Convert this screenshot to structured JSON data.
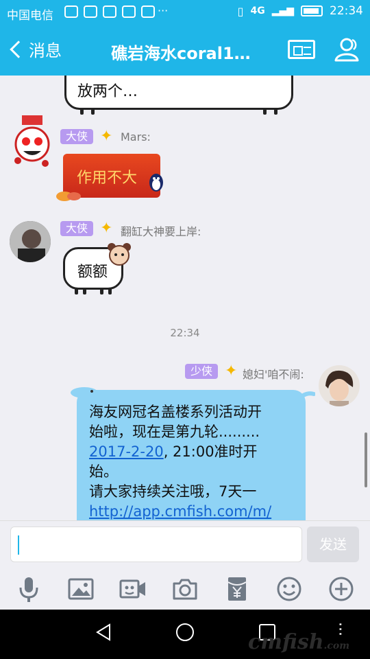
{
  "status_bar": {
    "carrier": "中国电信",
    "network": "4G",
    "time": "22:34"
  },
  "header": {
    "back_label": "消息",
    "title": "礁岩海水coral1…"
  },
  "messages": [
    {
      "type": "text-partial",
      "text": "放两个…"
    },
    {
      "type": "image",
      "badge": "大侠",
      "sender": "Mars:",
      "text": "作用不大"
    },
    {
      "type": "text",
      "badge": "大侠",
      "sender": "翻缸大神要上岸:",
      "text": "额额"
    }
  ],
  "timestamp": "22:34",
  "own_message": {
    "badge": "少侠",
    "sender": "媳妇'咱不闹:",
    "line1": "海友网冠名盖楼系列活动开",
    "line2": "始啦，现在是第九轮.........",
    "link_date": "2017-2-20",
    "line3_rest": ", 21:00准时开",
    "line4": "始。",
    "line5": "请大家持续关注哦，7天一",
    "link_url": "http://app.cmfish.com/m/"
  },
  "composer": {
    "placeholder": "",
    "send_label": "发送"
  },
  "watermark": {
    "text": "cmfish",
    "suffix": ".com"
  },
  "colors": {
    "accent": "#1fb6e8",
    "bubble_blue": "#8fd3f5",
    "badge_purple": "#b79af0"
  }
}
